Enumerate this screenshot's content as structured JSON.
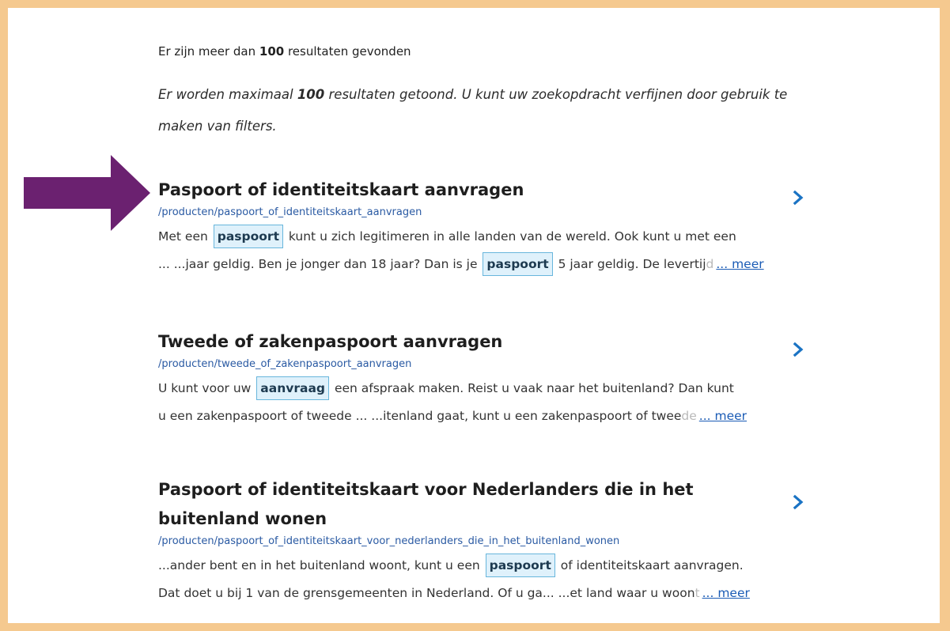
{
  "summary": {
    "count_prefix": "Er zijn meer dan ",
    "count_number": "100",
    "count_suffix": " resultaten gevonden",
    "notice_prefix": "Er worden maximaal ",
    "notice_number": "100",
    "notice_suffix": " resultaten getoond. U kunt uw zoekopdracht verfijnen door gebruik te maken van filters."
  },
  "results": [
    {
      "title": "Paspoort of identiteitskaart aanvragen",
      "url": "/producten/paspoort_of_identiteitskaart_aanvragen",
      "line1_a": "Met een ",
      "line1_hl": "paspoort",
      "line1_b": " kunt u zich legitimeren in alle landen van de wereld. Ook kunt u met een",
      "line2_a": "... ...jaar geldig. Ben je jonger dan 18 jaar? Dan is je ",
      "line2_hl": "paspoort",
      "line2_b": " 5 jaar geldig. De levertij",
      "line2_fade": "d",
      "more": "... meer"
    },
    {
      "title": "Tweede of zakenpaspoort aanvragen",
      "url": "/producten/tweede_of_zakenpaspoort_aanvragen",
      "line1_a": "U kunt voor uw ",
      "line1_hl": "aanvraag",
      "line1_b": " een  afspraak  maken. Reist u vaak naar het buitenland? Dan kunt",
      "line2_a": "u een zakenpaspoort of tweede ... ...itenland gaat, kunt u een zakenpaspoort of twee",
      "line2_hl": "",
      "line2_b": "",
      "line2_fade": "de",
      "more": "... meer"
    },
    {
      "title": "Paspoort of identiteitskaart voor Nederlanders die in het buitenland wonen",
      "url": "/producten/paspoort_of_identiteitskaart_voor_nederlanders_die_in_het_buitenland_wonen",
      "line1_a": "...ander bent en in het buitenland woont, kunt u een ",
      "line1_hl": "paspoort",
      "line1_b": " of identiteitskaart aanvragen.",
      "line2_a": "Dat doet u bij 1 van de grensgemeenten in Nederland. Of u ga... ...et land waar u woon",
      "line2_hl": "",
      "line2_b": "",
      "line2_fade": "t",
      "more": "... meer"
    }
  ],
  "colors": {
    "frame": "#f5c98f",
    "arrow": "#6b2170",
    "link": "#1a5bb5",
    "chevron": "#1a73c4",
    "highlight_bg": "#dff1fb",
    "highlight_border": "#68b6dc"
  },
  "icons": {
    "pointer": "arrow-right-icon",
    "chevron": "chevron-right-icon"
  }
}
